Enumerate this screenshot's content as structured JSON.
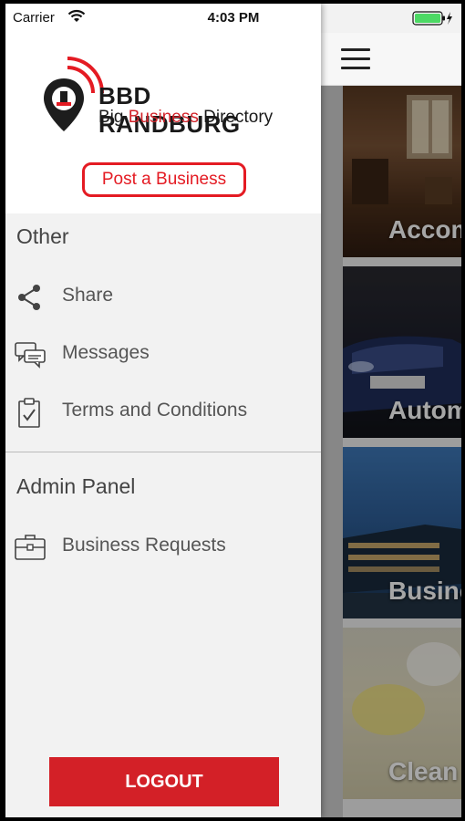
{
  "status_bar": {
    "carrier": "Carrier",
    "time": "4:03 PM"
  },
  "drawer": {
    "logo": {
      "title": "BBD RANDBURG",
      "subtitle_part1": "Big ",
      "subtitle_highlight": "Business",
      "subtitle_part2": " Directory"
    },
    "post_button": "Post a Business",
    "sections": {
      "other": {
        "title": "Other",
        "items": [
          {
            "label": "Share",
            "icon": "share-icon"
          },
          {
            "label": "Messages",
            "icon": "messages-icon"
          },
          {
            "label": "Terms and Conditions",
            "icon": "clipboard-check-icon"
          }
        ]
      },
      "admin": {
        "title": "Admin Panel",
        "items": [
          {
            "label": "Business Requests",
            "icon": "briefcase-icon"
          }
        ]
      }
    },
    "logout": "LOGOUT"
  },
  "main": {
    "categories": [
      {
        "label": "Accom"
      },
      {
        "label": "Autom"
      },
      {
        "label": "Busine"
      },
      {
        "label": "Clean"
      }
    ]
  },
  "colors": {
    "accent_red": "#d32027",
    "battery_green": "#4cd964"
  }
}
